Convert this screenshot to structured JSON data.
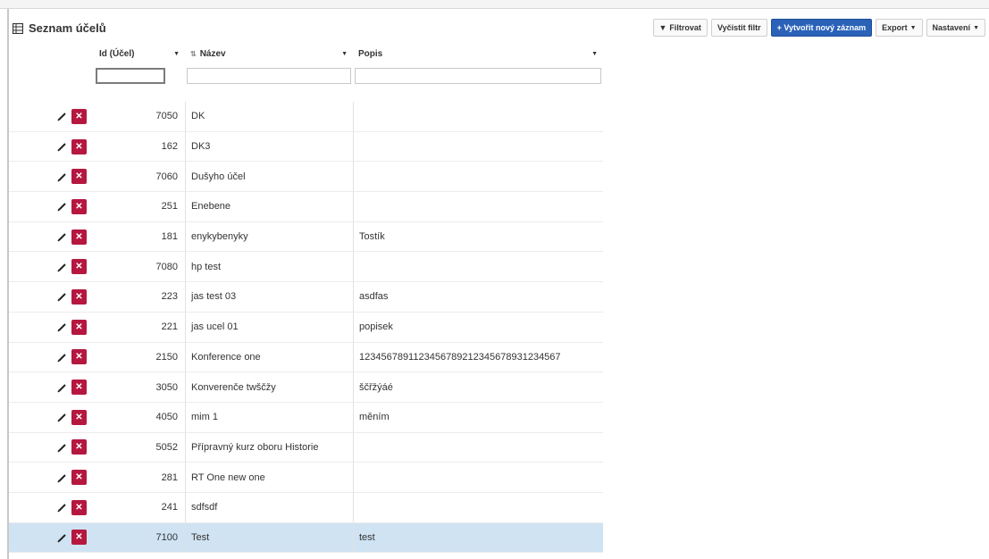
{
  "page": {
    "title": "Seznam účelů"
  },
  "toolbar": {
    "filter_label": "Filtrovat",
    "clear_label": "Vyčistit filtr",
    "new_label": "+ Vytvořit nový záznam",
    "export_label": "Export",
    "settings_label": "Nastavení"
  },
  "columns": {
    "id": "Id (Účel)",
    "name": "Název",
    "desc": "Popis"
  },
  "filters": {
    "id_placeholder": "",
    "name_placeholder": "",
    "desc_placeholder": ""
  },
  "rows": [
    {
      "id": "7050",
      "name": "DK",
      "desc": ""
    },
    {
      "id": "162",
      "name": "DK3",
      "desc": ""
    },
    {
      "id": "7060",
      "name": "Dušyho účel",
      "desc": ""
    },
    {
      "id": "251",
      "name": "Enebene",
      "desc": ""
    },
    {
      "id": "181",
      "name": "enykybenyky",
      "desc": "Tostík"
    },
    {
      "id": "7080",
      "name": "hp test",
      "desc": ""
    },
    {
      "id": "223",
      "name": "jas test 03",
      "desc": "asdfas"
    },
    {
      "id": "221",
      "name": "jas ucel 01",
      "desc": "popisek"
    },
    {
      "id": "2150",
      "name": "Konference one",
      "desc": "1234567891123456789212345678931234567"
    },
    {
      "id": "3050",
      "name": "Konverenče twščžy",
      "desc": "ščřžýáé"
    },
    {
      "id": "4050",
      "name": "mim 1",
      "desc": "měním"
    },
    {
      "id": "5052",
      "name": "Přípravný kurz oboru Historie",
      "desc": ""
    },
    {
      "id": "281",
      "name": "RT One new one",
      "desc": ""
    },
    {
      "id": "241",
      "name": "sdfsdf",
      "desc": ""
    },
    {
      "id": "7100",
      "name": "Test",
      "desc": "test"
    }
  ],
  "colors": {
    "primary": "#2a62b8",
    "delete": "#b5173f",
    "selected_row": "#cfe3f3"
  }
}
